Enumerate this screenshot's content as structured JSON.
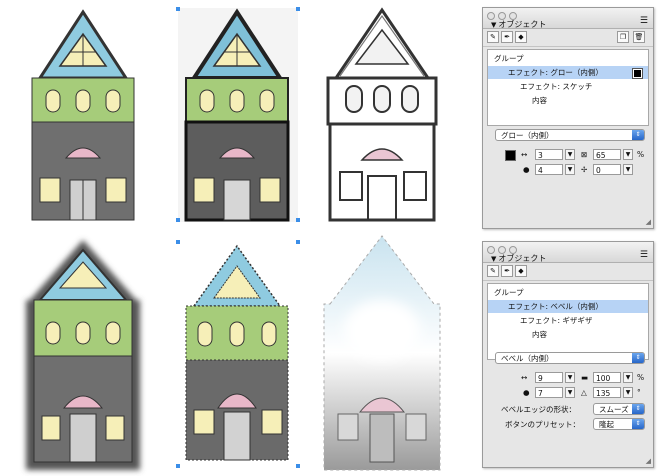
{
  "panel_top": {
    "title": "オブジェクト",
    "list_items": [
      "グループ",
      "エフェクト: グロー（内側）",
      "エフェクト: スケッチ",
      "内容"
    ],
    "effect_select": "グロー（内側）",
    "width_value": "3",
    "opacity_value": "65",
    "percent_unit": "%",
    "softness_value": "4",
    "offset_value": "0"
  },
  "panel_bottom": {
    "title": "オブジェクト",
    "list_items": [
      "グループ",
      "エフェクト: ベベル（内側）",
      "エフェクト: ギザギザ",
      "内容"
    ],
    "effect_select": "ベベル（内側）",
    "width_value": "9",
    "contrast_value": "100",
    "percent_unit": "%",
    "softness_value": "7",
    "angle_value": "135",
    "degree_unit": "°",
    "bevel_shape_label": "ベベルエッジの形状：",
    "bevel_shape_value": "スムーズ",
    "button_preset_label": "ボタンのプリセット：",
    "button_preset_value": "隆起"
  },
  "icons": [
    "menu-icon",
    "pencil-icon",
    "pen-tool-icon",
    "fill-icon",
    "new-layer-icon",
    "trash-icon",
    "width-arrow-icon",
    "softness-icon",
    "offset-icon",
    "angle-icon",
    "contrast-icon",
    "color-swatch-icon",
    "resize-grip-icon"
  ],
  "colors": {
    "roof": "#8fcbe0",
    "middle": "#a6cc7a",
    "base": "#6f6f6f",
    "awning": "#e8b7c8",
    "window": "#f6efb8",
    "selection": "#3b8ee8",
    "list_highlight": "#b7d3f5"
  }
}
